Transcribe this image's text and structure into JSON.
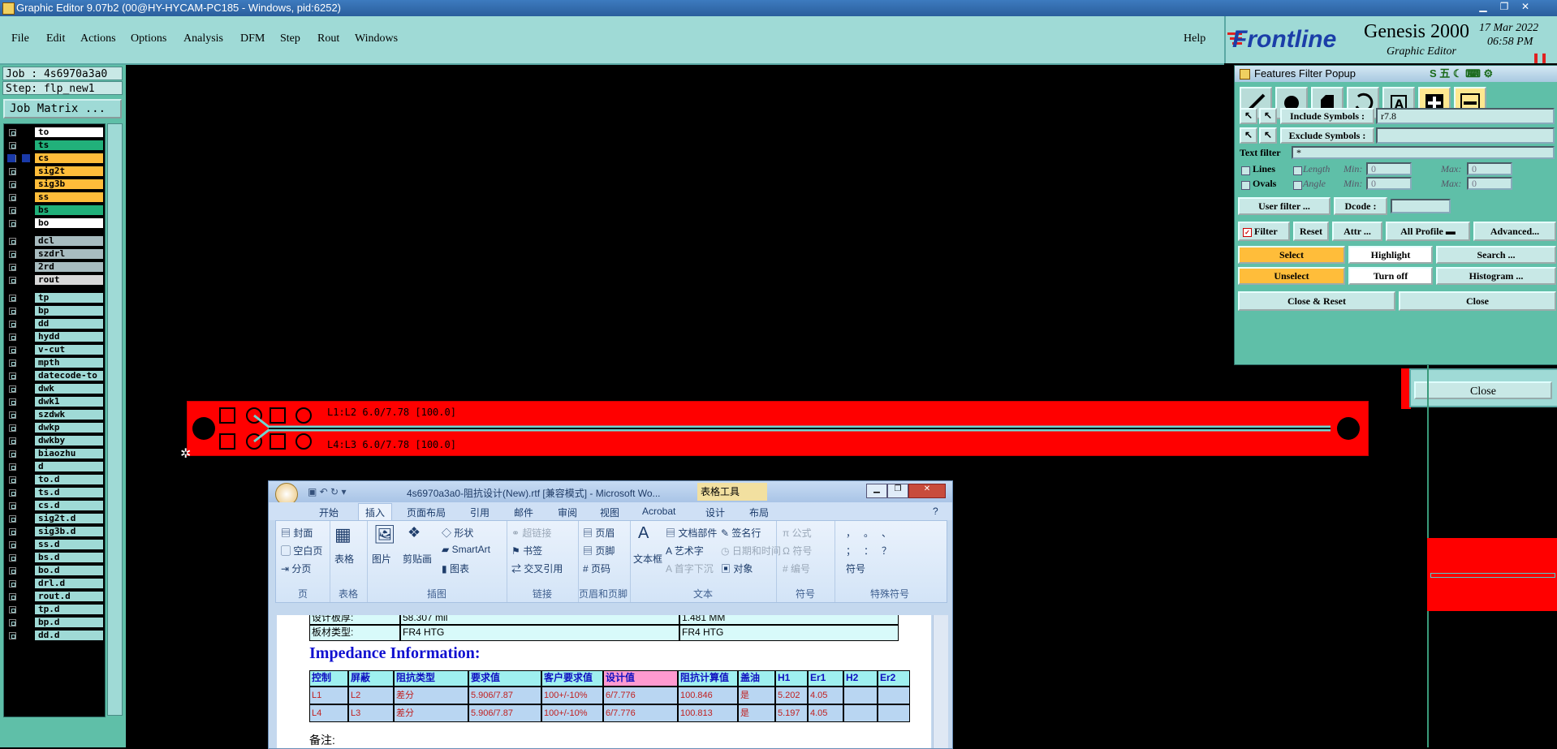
{
  "window": {
    "title": "Graphic Editor 9.07b2 (00@HY-HYCAM-PC185 - Windows, pid:6252)"
  },
  "menu": {
    "items": [
      "File",
      "Edit",
      "Actions",
      "Options",
      "Analysis",
      "DFM",
      "Step",
      "Rout",
      "Windows"
    ],
    "help": "Help"
  },
  "brand": {
    "logo": "Frontline",
    "product": "Genesis 2000",
    "subtitle": "Graphic Editor",
    "date": "17 Mar 2022",
    "time": "06:58 PM"
  },
  "job": {
    "job_label": "Job : 4s6970a3a0",
    "step_label": "Step: flp_new1",
    "matrix_button": "Job Matrix ..."
  },
  "layers": [
    {
      "name": "to",
      "color": "#ffffff"
    },
    {
      "name": "ts",
      "color": "#21b07a"
    },
    {
      "name": "cs",
      "color": "#ffbd3a"
    },
    {
      "name": "sig2t",
      "color": "#ffbd3a"
    },
    {
      "name": "sig3b",
      "color": "#ffbd3a"
    },
    {
      "name": "ss",
      "color": "#ffbd3a"
    },
    {
      "name": "bs",
      "color": "#21b07a"
    },
    {
      "name": "bo",
      "color": "#ffffff"
    },
    {
      "name": "dcl",
      "color": "#a8bcc0"
    },
    {
      "name": "szdrl",
      "color": "#a8bcc0"
    },
    {
      "name": "2rd",
      "color": "#a8bcc0"
    },
    {
      "name": "rout",
      "color": "#d8d8d8"
    },
    {
      "name": "tp",
      "color": "#9fdad6"
    },
    {
      "name": "bp",
      "color": "#9fdad6"
    },
    {
      "name": "dd",
      "color": "#9fdad6"
    },
    {
      "name": "hydd",
      "color": "#9fdad6"
    },
    {
      "name": "v-cut",
      "color": "#9fdad6"
    },
    {
      "name": "mpth",
      "color": "#9fdad6"
    },
    {
      "name": "datecode-to",
      "color": "#9fdad6"
    },
    {
      "name": "dwk",
      "color": "#9fdad6"
    },
    {
      "name": "dwk1",
      "color": "#9fdad6"
    },
    {
      "name": "szdwk",
      "color": "#9fdad6"
    },
    {
      "name": "dwkp",
      "color": "#9fdad6"
    },
    {
      "name": "dwkby",
      "color": "#9fdad6"
    },
    {
      "name": "biaozhu",
      "color": "#9fdad6"
    },
    {
      "name": "d",
      "color": "#9fdad6"
    },
    {
      "name": "to.d",
      "color": "#9fdad6"
    },
    {
      "name": "ts.d",
      "color": "#9fdad6"
    },
    {
      "name": "cs.d",
      "color": "#9fdad6"
    },
    {
      "name": "sig2t.d",
      "color": "#9fdad6"
    },
    {
      "name": "sig3b.d",
      "color": "#9fdad6"
    },
    {
      "name": "ss.d",
      "color": "#9fdad6"
    },
    {
      "name": "bs.d",
      "color": "#9fdad6"
    },
    {
      "name": "bo.d",
      "color": "#9fdad6"
    },
    {
      "name": "drl.d",
      "color": "#9fdad6"
    },
    {
      "name": "rout.d",
      "color": "#9fdad6"
    },
    {
      "name": "tp.d",
      "color": "#9fdad6"
    },
    {
      "name": "bp.d",
      "color": "#9fdad6"
    },
    {
      "name": "dd.d",
      "color": "#9fdad6"
    }
  ],
  "pcb": {
    "label_top": "L1:L2 6.0/7.78 [100.0]",
    "label_bottom": "L4:L3 6.0/7.78 [100.0]"
  },
  "filter": {
    "title": "Features Filter Popup",
    "include_label": "Include Symbols :",
    "include_value": "r7.8",
    "exclude_label": "Exclude Symbols :",
    "exclude_value": "",
    "text_filter_label": "Text filter",
    "text_filter_value": "*",
    "lines_label": "Lines",
    "ovals_label": "Ovals",
    "length_label": "Length",
    "angle_label": "Angle",
    "min_label": "Min:",
    "max_label": "Max:",
    "min_len": "0",
    "max_len": "0",
    "min_ang": "0",
    "max_ang": "0",
    "user_filter": "User filter ...",
    "dcode_label": "Dcode :",
    "dcode_value": "",
    "filter_label": "Filter",
    "reset": "Reset",
    "attr": "Attr ...",
    "profile": "All Profile",
    "advanced": "Advanced...",
    "select": "Select",
    "highlight": "Highlight",
    "search": "Search ...",
    "unselect": "Unselect",
    "turn_off": "Turn off",
    "histogram": "Histogram ...",
    "close_reset": "Close & Reset",
    "close": "Close",
    "bg_close": "Close",
    "accent": "#ffbd3a"
  },
  "word": {
    "title": "4s6970a3a0-阻抗设计(New).rtf [兼容模式] - Microsoft Wo...",
    "context_tab": "表格工具",
    "tabs": [
      "开始",
      "插入",
      "页面布局",
      "引用",
      "邮件",
      "审阅",
      "视图",
      "Acrobat",
      "设计",
      "布局"
    ],
    "groups": {
      "page": {
        "label": "页",
        "items": [
          "封面",
          "空白页",
          "分页"
        ]
      },
      "table": {
        "label": "表格",
        "items": [
          "表格"
        ]
      },
      "illus": {
        "label": "插图",
        "items": [
          "图片",
          "剪贴画",
          "形状",
          "SmartArt",
          "图表"
        ]
      },
      "links": {
        "label": "链接",
        "items": [
          "超链接",
          "书签",
          "交叉引用"
        ]
      },
      "header": {
        "label": "页眉和页脚",
        "items": [
          "页眉",
          "页脚",
          "页码"
        ]
      },
      "text": {
        "label": "文本",
        "items": [
          "文本框",
          "文档部件",
          "艺术字",
          "首字下沉",
          "签名行",
          "日期和时间",
          "对象"
        ]
      },
      "symbols": {
        "label": "符号",
        "items": [
          "公式",
          "符号",
          "编号"
        ]
      },
      "special": {
        "label": "特殊符号",
        "items": [
          "，",
          "。",
          "、",
          "；",
          "：",
          "？",
          "符号"
        ]
      }
    },
    "doc": {
      "row1": [
        "设计板厚:",
        "58.307 mil",
        "1.481 MM"
      ],
      "row2": [
        "板材类型:",
        "FR4 HTG",
        "FR4 HTG"
      ],
      "heading": "Impedance Information:",
      "headers": [
        "控制",
        "屏蔽",
        "阻抗类型",
        "要求值",
        "客户要求值",
        "设计值",
        "阻抗计算值",
        "盖油",
        "H1",
        "Er1",
        "H2",
        "Er2"
      ],
      "rows": [
        [
          "L1",
          "L2",
          "差分",
          "5.906/7.87",
          "100+/-10%",
          "6/7.776",
          "100.846",
          "是",
          "5.202",
          "4.05",
          "",
          ""
        ],
        [
          "L4",
          "L3",
          "差分",
          "5.906/7.87",
          "100+/-10%",
          "6/7.776",
          "100.813",
          "是",
          "5.197",
          "4.05",
          "",
          ""
        ]
      ],
      "note": "备注:"
    }
  }
}
